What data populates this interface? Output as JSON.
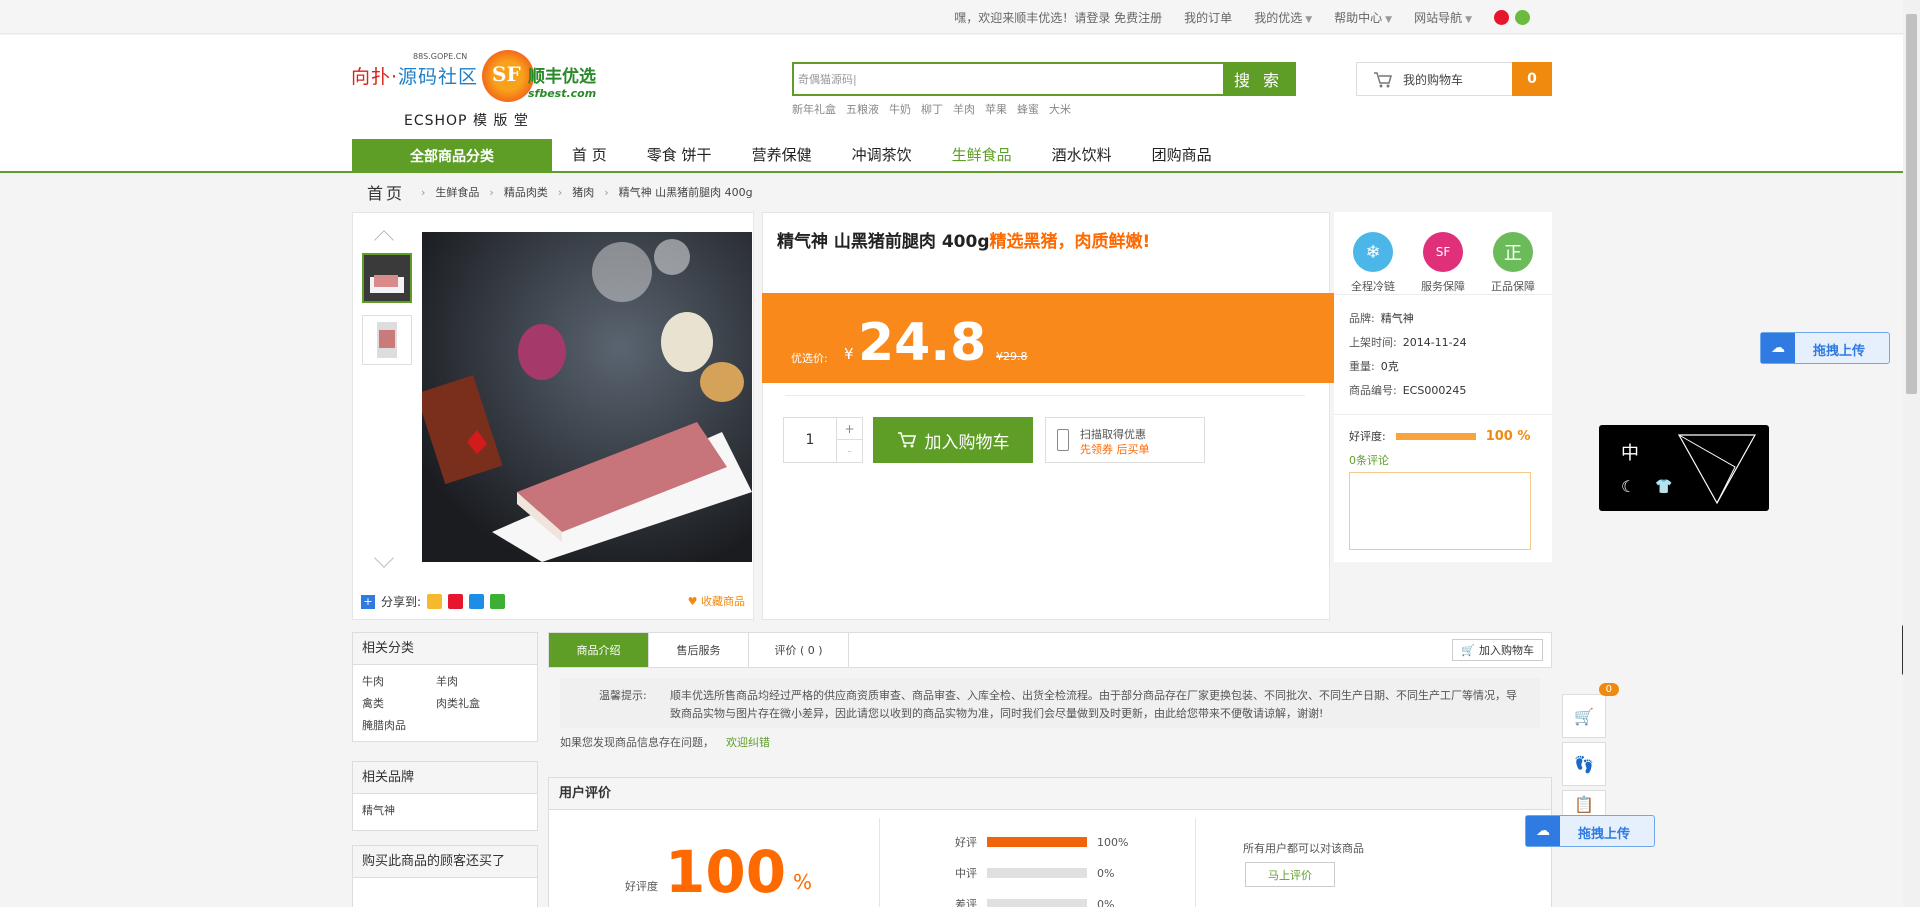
{
  "topbar": {
    "welcome": "嘿，欢迎来顺丰优选！",
    "login": "请登录",
    "register": "免费注册",
    "my_orders": "我的订单",
    "my_youxuan": "我的优选",
    "help": "帮助中心",
    "site_nav": "网站导航"
  },
  "logo": {
    "left_blue": "源码社区",
    "left_red": "向扑·",
    "left_sub": "88S.GOPE.CN",
    "sf_letters": "SF",
    "brand": "顺丰优选",
    "brand_url": "sfbest.com",
    "caption": "ECSHOP 模 版 堂"
  },
  "search": {
    "value": "奇偶猫源码|",
    "button": "搜 索",
    "hot": [
      "新年礼盒",
      "五粮液",
      "牛奶",
      "柳丁",
      "羊肉",
      "苹果",
      "蜂蜜",
      "大米"
    ]
  },
  "cart": {
    "label": "我的购物车",
    "count": "0"
  },
  "nav": {
    "all": "全部商品分类",
    "links": [
      "首  页",
      "零食 饼干",
      "营养保健",
      "冲调茶饮",
      "生鲜食品",
      "酒水饮料",
      "团购商品"
    ]
  },
  "breadcrumb": {
    "home": "首页",
    "items": [
      "生鲜食品",
      "精品肉类",
      "猪肉",
      "精气神 山黑猪前腿肉 400g"
    ]
  },
  "gallery": {
    "share_label": "分享到:",
    "favorite": "收藏商品"
  },
  "product": {
    "title": "精气神 山黑猪前腿肉 400g",
    "promo": "精选黑猪，肉质鲜嫩!",
    "price_label": "优选价:",
    "currency": "¥",
    "price": "24.8",
    "old_price": "¥29.8",
    "quantity": "1",
    "plus": "+",
    "minus": "-",
    "add_to_cart": "加入购物车",
    "scan_line1": "扫描取得优惠",
    "scan_line2": "先领券 后买单"
  },
  "side": {
    "guarantees": [
      {
        "label": "全程冷链",
        "glyph": "❄",
        "color": "#4bb6e8"
      },
      {
        "label": "服务保障",
        "glyph": "SF",
        "color": "#e0307a"
      },
      {
        "label": "正品保障",
        "glyph": "正",
        "color": "#6bbb5a"
      }
    ],
    "brand_k": "品牌:",
    "brand_v": "精气神",
    "date_k": "上架时间:",
    "date_v": "2014-11-24",
    "weight_k": "重量:",
    "weight_v": "0克",
    "sku_k": "商品编号:",
    "sku_v": "ECS000245",
    "rating_k": "好评度:",
    "rating_pct": "100 %",
    "rating_value": 100,
    "comments": "0条评论"
  },
  "related_cats": {
    "title": "相关分类",
    "items": [
      "牛肉",
      "羊肉",
      "禽类",
      "肉类礼盒",
      "腌腊肉品"
    ]
  },
  "related_brands": {
    "title": "相关品牌",
    "items": [
      "精气神"
    ]
  },
  "also_bought": {
    "title": "购买此商品的顾客还买了"
  },
  "tabs": {
    "items": [
      "商品介绍",
      "售后服务",
      "评价 ( 0 )"
    ],
    "cart_btn": "加入购物车"
  },
  "tip": {
    "label": "温馨提示:",
    "text": "顺丰优选所售商品均经过严格的供应商资质审查、商品审查、入库全检、出货全检流程。由于部分商品存在厂家更换包装、不同批次、不同生产日期、不同生产工厂等情况，导致商品实物与图片存在微小差异，因此请您以收到的商品实物为准，同时我们会尽量做到及时更新，由此给您带来不便敬请谅解，谢谢!"
  },
  "report": {
    "text": "如果您发现商品信息存在问题，",
    "link": "欢迎纠错"
  },
  "review": {
    "title": "用户评价",
    "good_label": "好评度",
    "good_pct": "100",
    "pct_sign": "%",
    "rows": [
      {
        "label": "好评",
        "value": 100,
        "text": "100%"
      },
      {
        "label": "中评",
        "value": 0,
        "text": "0%"
      },
      {
        "label": "差评",
        "value": 0,
        "text": "0%"
      }
    ],
    "note": "所有用户都可以对该商品",
    "write": "马上评价"
  },
  "float": {
    "upload": "拖拽上传",
    "cart_badge": "0",
    "dark_text": "中"
  }
}
